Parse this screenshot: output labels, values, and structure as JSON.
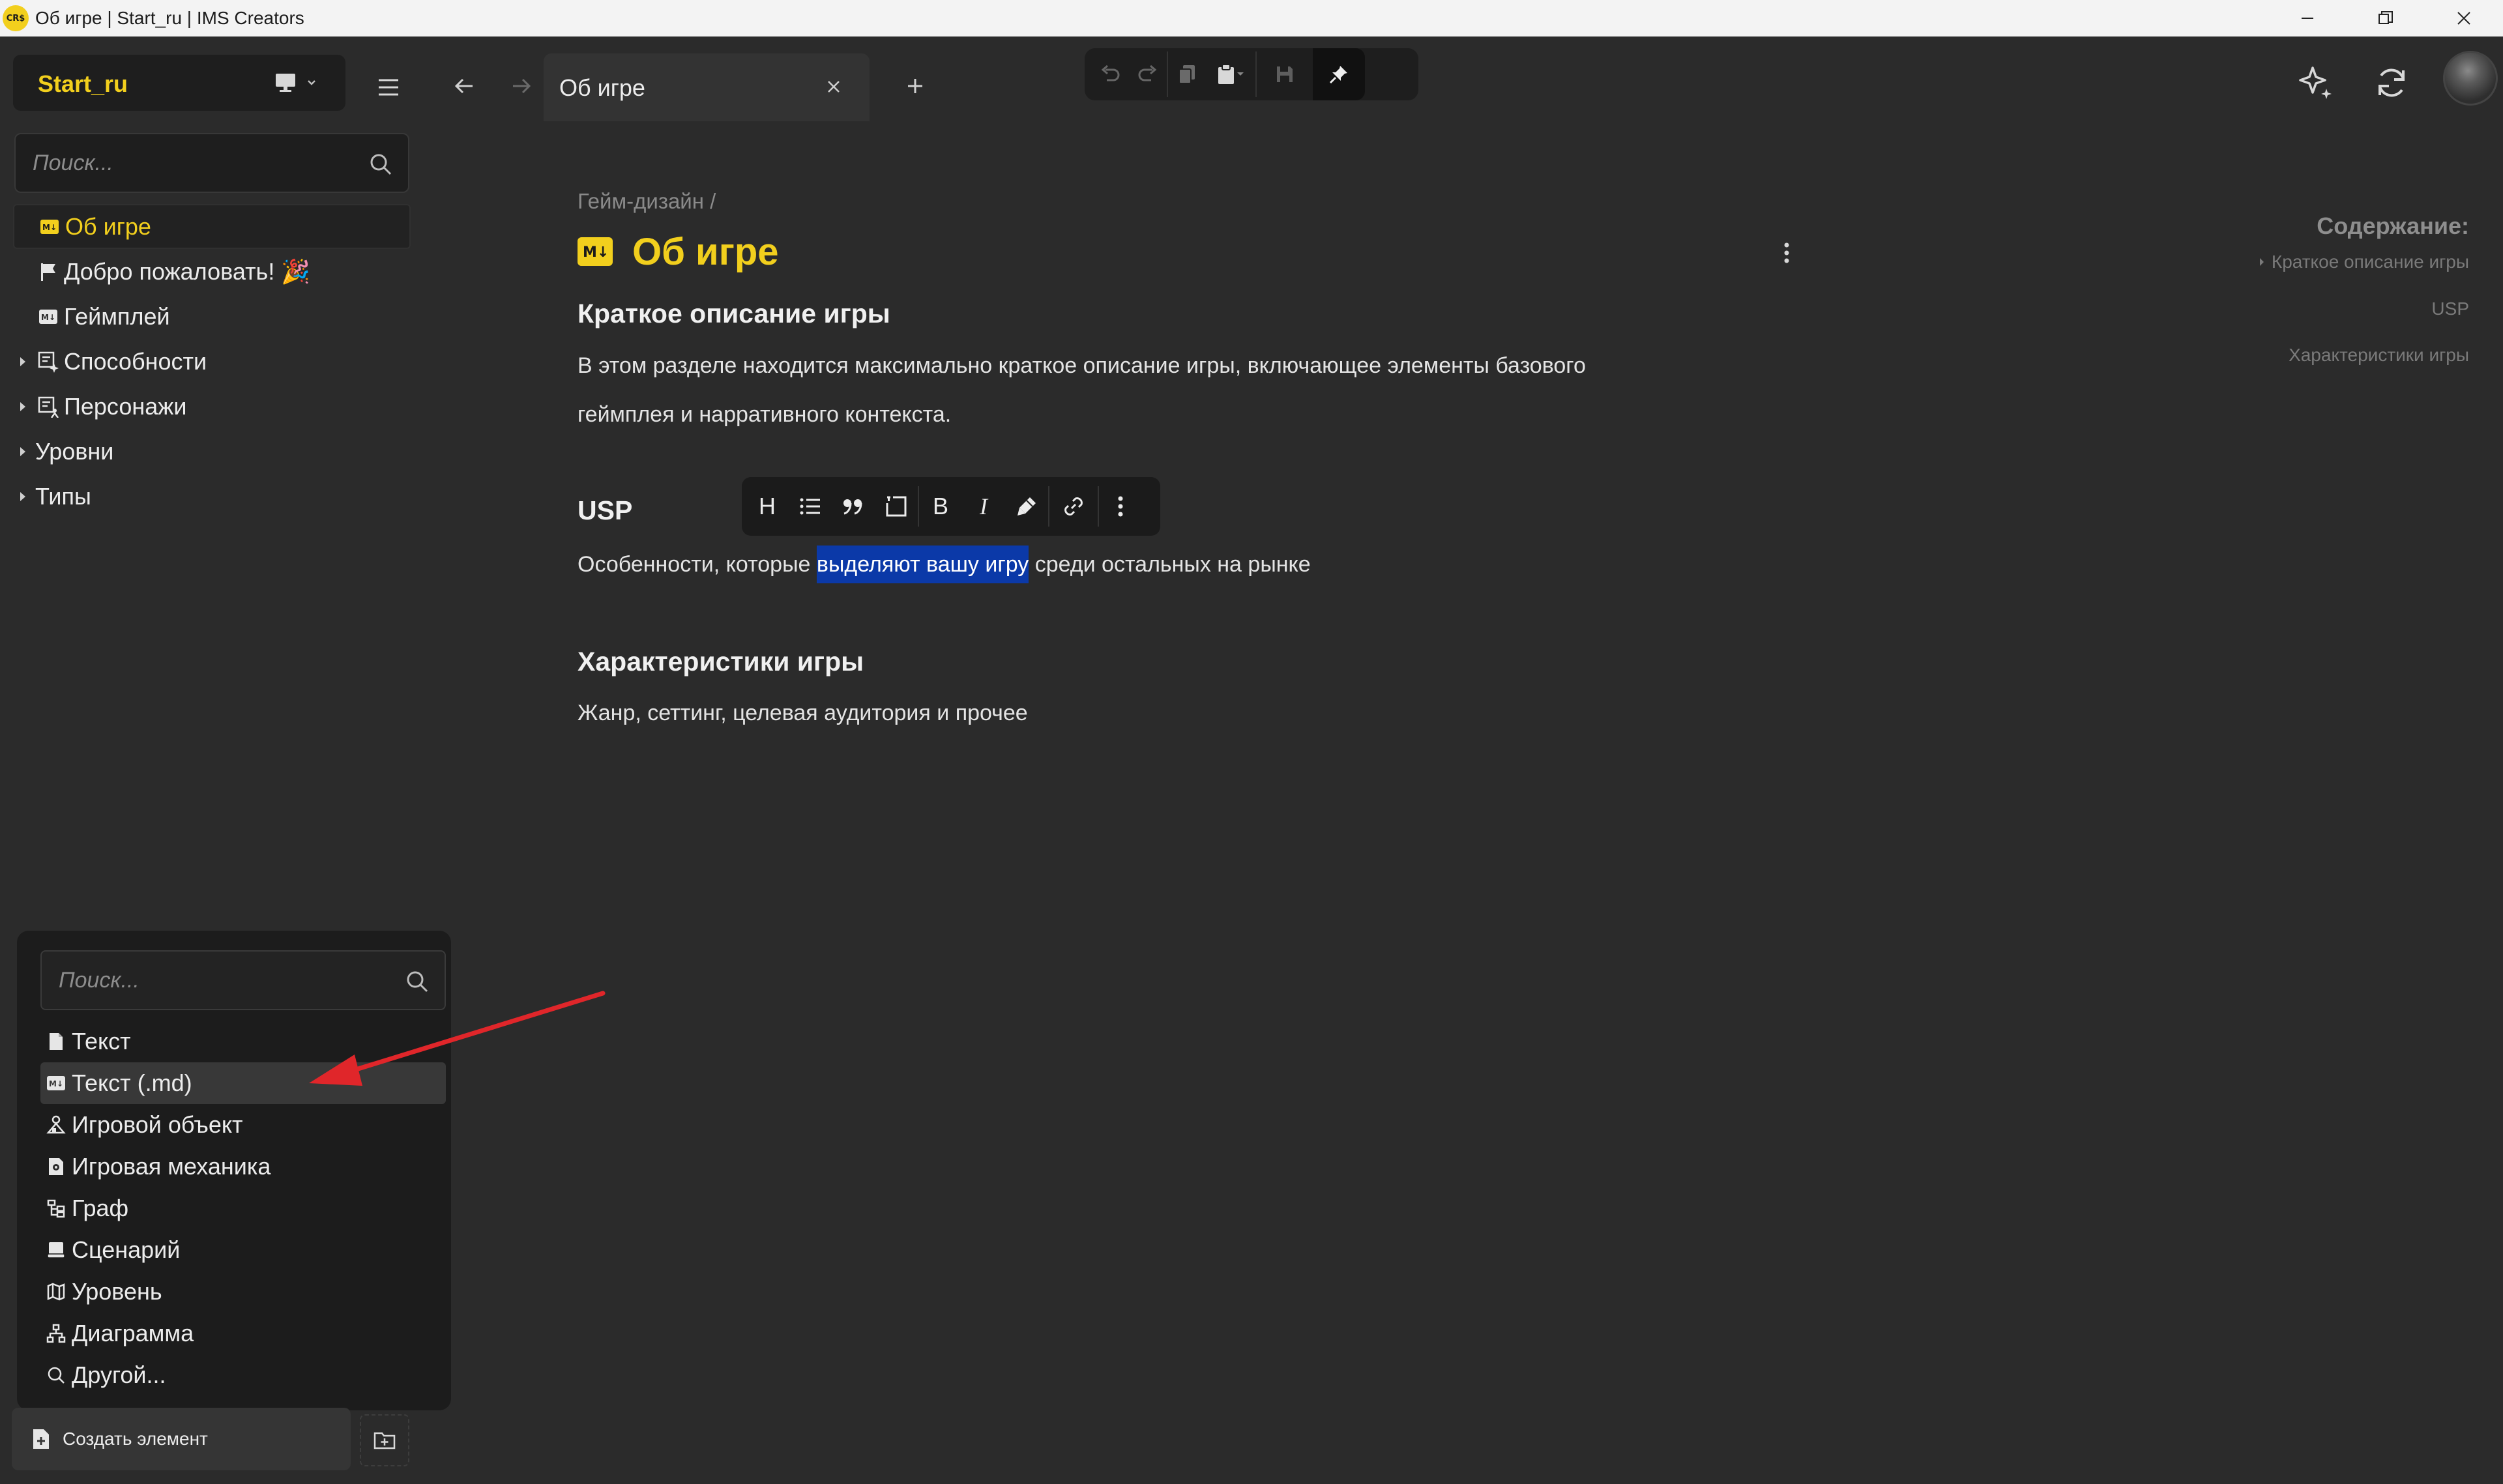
{
  "window": {
    "title": "Об игре | Start_ru | IMS Creators",
    "logo_text": "CR$"
  },
  "sidebar": {
    "project_name": "Start_ru",
    "search_placeholder": "Поиск...",
    "items": [
      {
        "label": "Об игре",
        "icon": "markdown-icon",
        "active": true
      },
      {
        "label": "Добро пожаловать! 🎉",
        "icon": "flag-icon"
      },
      {
        "label": "Геймплей",
        "icon": "markdown-icon"
      },
      {
        "label": "Способности",
        "icon": "abilities-icon",
        "expandable": true
      },
      {
        "label": "Персонажи",
        "icon": "characters-icon",
        "expandable": true
      },
      {
        "label": "Уровни",
        "expandable": true
      },
      {
        "label": "Типы",
        "expandable": true
      }
    ]
  },
  "create_popup": {
    "search_placeholder": "Поиск...",
    "items": [
      {
        "label": "Текст",
        "icon": "document-icon"
      },
      {
        "label": "Текст (.md)",
        "icon": "markdown-icon",
        "hover": true
      },
      {
        "label": "Игровой объект",
        "icon": "game-object-icon"
      },
      {
        "label": "Игровая механика",
        "icon": "game-mechanic-icon"
      },
      {
        "label": "Граф",
        "icon": "graph-icon"
      },
      {
        "label": "Сценарий",
        "icon": "script-icon"
      },
      {
        "label": "Уровень",
        "icon": "map-icon"
      },
      {
        "label": "Диаграмма",
        "icon": "diagram-icon"
      },
      {
        "label": "Другой...",
        "icon": "search-icon"
      }
    ],
    "create_button_label": "Создать элемент"
  },
  "tabs": {
    "active_label": "Об игре"
  },
  "document": {
    "breadcrumb": "Гейм-дизайн /",
    "title": "Об игре",
    "sections": [
      {
        "heading": "Краткое описание игры",
        "lines": [
          "В этом разделе находится максимально краткое описание игры, включающее элементы базового",
          "геймплея и нарративного контекста."
        ]
      },
      {
        "heading": "USP",
        "text_before": "Особенности, которые ",
        "text_selected": "выделяют вашу игру",
        "text_after": " среди остальных на рынке"
      },
      {
        "heading": "Характеристики игры",
        "lines": [
          "Жанр, сеттинг, целевая аудитория и прочее"
        ]
      }
    ]
  },
  "format_toolbar": {
    "heading": "H",
    "bold": "B",
    "italic": "I"
  },
  "toc": {
    "title": "Содержание:",
    "items": [
      "Краткое описание игры",
      "USP",
      "Характеристики игры"
    ]
  },
  "colors": {
    "accent": "#f2cf1d",
    "background": "#2b2b2b",
    "panel": "#1e1e1e",
    "selection": "#0b39a8",
    "annotation_arrow": "#e0262a"
  }
}
